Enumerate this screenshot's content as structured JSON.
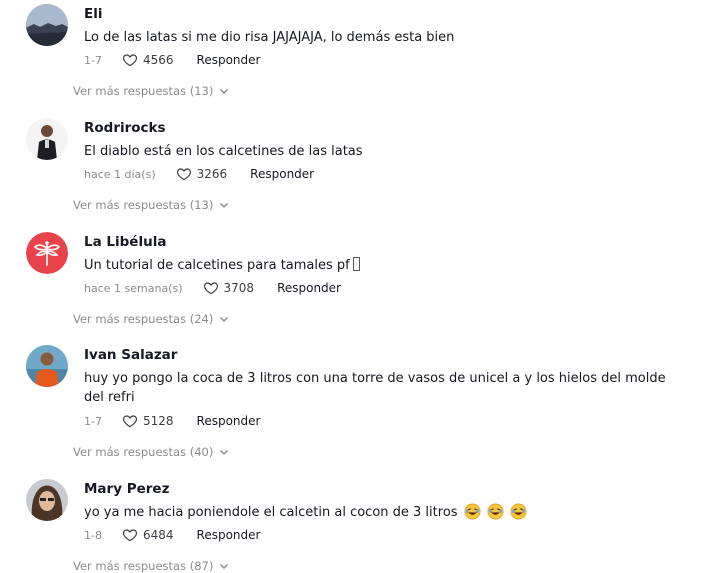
{
  "comments": [
    {
      "username": "Eli",
      "text": "Lo de las latas si me dio risa JAJAJAJA, lo demás esta bien",
      "date": "1-7",
      "likes": "4566",
      "reply_label": "Responder",
      "more_replies": "Ver más respuestas (13)"
    },
    {
      "username": "Rodrirocks",
      "text": "El diablo está en los calcetines de las latas",
      "date": "hace 1 día(s)",
      "likes": "3266",
      "reply_label": "Responder",
      "more_replies": "Ver más respuestas (13)"
    },
    {
      "username": "La Libélula",
      "text": "Un tutorial de calcetines para tamales pf",
      "date": "hace 1 semana(s)",
      "likes": "3708",
      "reply_label": "Responder",
      "more_replies": "Ver más respuestas (24)"
    },
    {
      "username": "Ivan Salazar",
      "text": "huy yo pongo la coca de 3 litros con una torre de vasos de unicel a y los hielos del molde del refri",
      "date": "1-7",
      "likes": "5128",
      "reply_label": "Responder",
      "more_replies": "Ver más respuestas (40)"
    },
    {
      "username": "Mary Perez",
      "text": "yo ya me hacia poniendole el calcetin al cocon de 3 litros",
      "date": "1-8",
      "likes": "6484",
      "reply_label": "Responder",
      "more_replies": "Ver más respuestas (87)"
    }
  ],
  "icons": {
    "like": "heart-icon",
    "expand": "chevron-down-icon",
    "emoji": "laughing-emoji-icon"
  },
  "colors": {
    "libelula_brand": "#e8434b",
    "muted_text": "#8a8b91"
  }
}
